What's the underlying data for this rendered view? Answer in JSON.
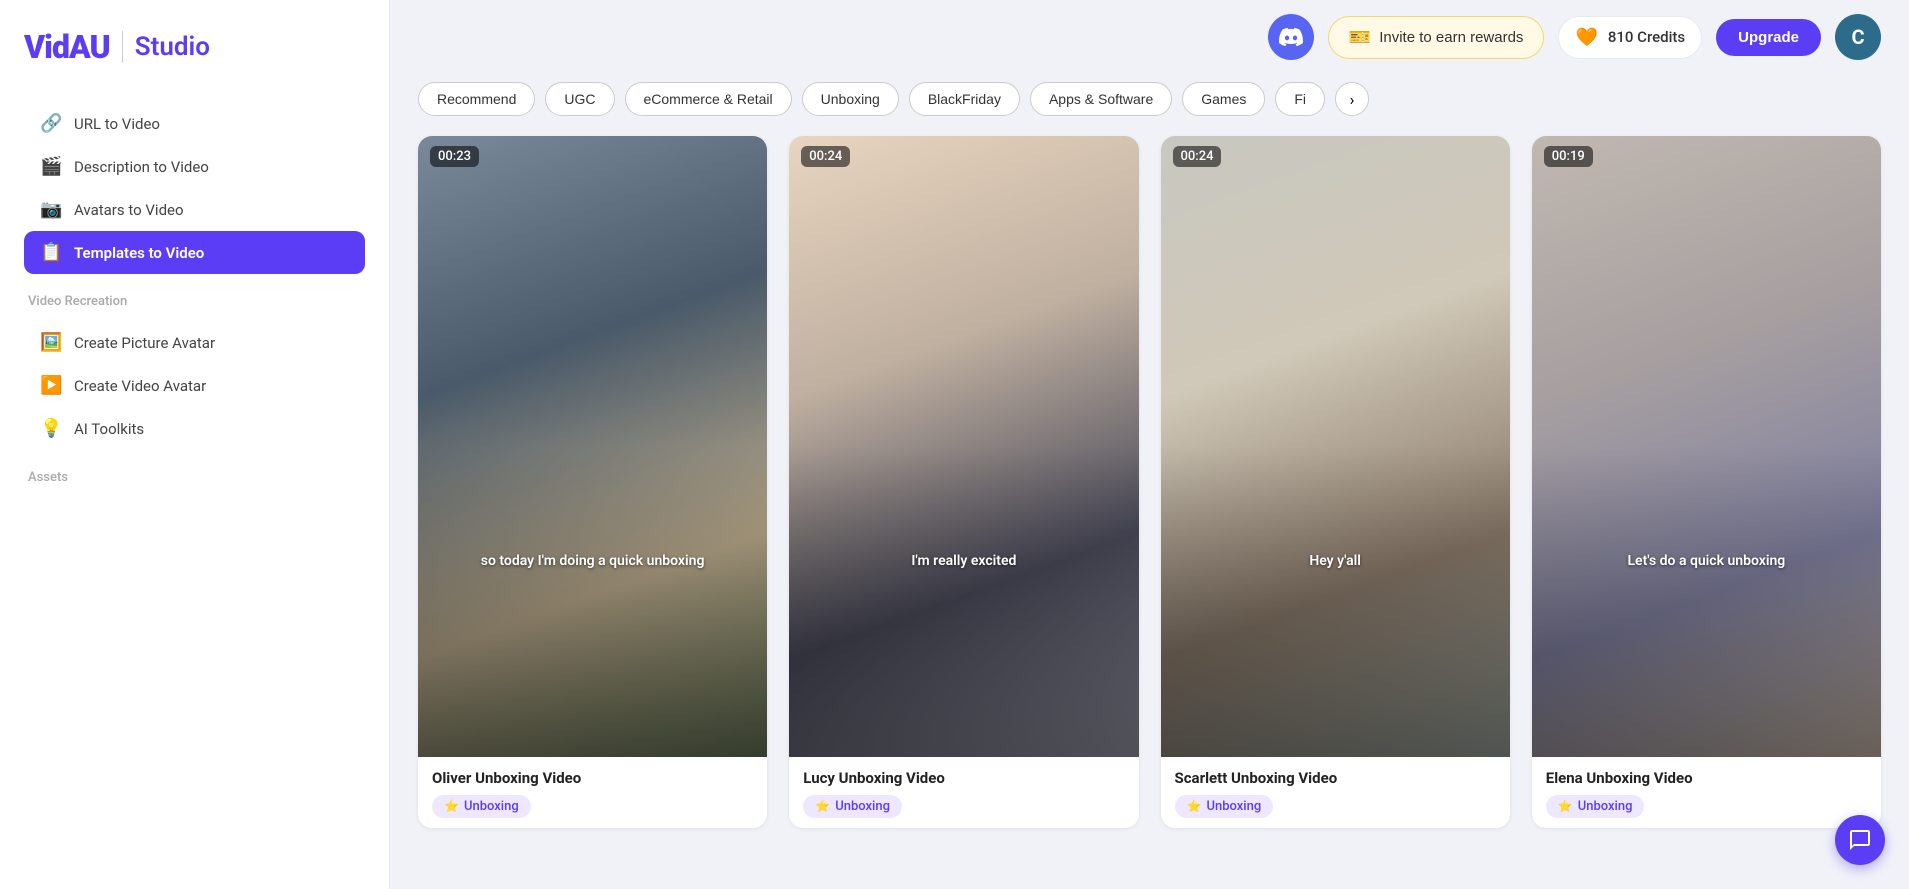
{
  "logo": {
    "app_name": "VidAU",
    "separator": "|",
    "subtitle": "Studio"
  },
  "sidebar": {
    "nav_items": [
      {
        "id": "url-to-video",
        "label": "URL to Video",
        "icon": "🔗",
        "active": false
      },
      {
        "id": "desc-to-video",
        "label": "Description to Video",
        "icon": "🎬",
        "active": false
      },
      {
        "id": "avatars-to-video",
        "label": "Avatars to Video",
        "icon": "📷",
        "active": false
      },
      {
        "id": "templates-to-video",
        "label": "Templates to Video",
        "icon": "📋",
        "active": true
      }
    ],
    "section_video_recreation": "Video Recreation",
    "video_recreation_items": [
      {
        "id": "create-picture-avatar",
        "label": "Create Picture Avatar",
        "icon": "🖼️"
      },
      {
        "id": "create-video-avatar",
        "label": "Create Video Avatar",
        "icon": "▶️"
      },
      {
        "id": "ai-toolkits",
        "label": "AI Toolkits",
        "icon": "💡"
      }
    ],
    "section_assets": "Assets"
  },
  "topbar": {
    "discord_label": "Discord",
    "invite_label": "Invite to earn rewards",
    "invite_icon": "🎫",
    "credits_label": "810 Credits",
    "credits_icon": "🧡",
    "upgrade_label": "Upgrade",
    "avatar_letter": "C"
  },
  "categories": [
    {
      "id": "recommend",
      "label": "Recommend",
      "active": false
    },
    {
      "id": "ugc",
      "label": "UGC",
      "active": false
    },
    {
      "id": "ecommerce-retail",
      "label": "eCommerce & Retail",
      "active": false
    },
    {
      "id": "unboxing",
      "label": "Unboxing",
      "active": false
    },
    {
      "id": "blackfriday",
      "label": "BlackFriday",
      "active": false
    },
    {
      "id": "apps-software",
      "label": "Apps & Software",
      "active": false
    },
    {
      "id": "games",
      "label": "Games",
      "active": false
    },
    {
      "id": "fi",
      "label": "Fi",
      "active": false
    }
  ],
  "videos": [
    {
      "id": "oliver",
      "title": "Oliver Unboxing Video",
      "duration": "00:23",
      "caption": "so today I'm doing a quick unboxing",
      "tag": "Unboxing",
      "bg_class": "bg-oliver"
    },
    {
      "id": "lucy",
      "title": "Lucy Unboxing Video",
      "duration": "00:24",
      "caption": "I'm really excited",
      "tag": "Unboxing",
      "bg_class": "bg-lucy"
    },
    {
      "id": "scarlett",
      "title": "Scarlett Unboxing Video",
      "duration": "00:24",
      "caption": "Hey y'all",
      "tag": "Unboxing",
      "bg_class": "bg-scarlett"
    },
    {
      "id": "elena",
      "title": "Elena Unboxing Video",
      "duration": "00:19",
      "caption": "Let's do a quick unboxing",
      "tag": "Unboxing",
      "bg_class": "bg-elena"
    }
  ]
}
